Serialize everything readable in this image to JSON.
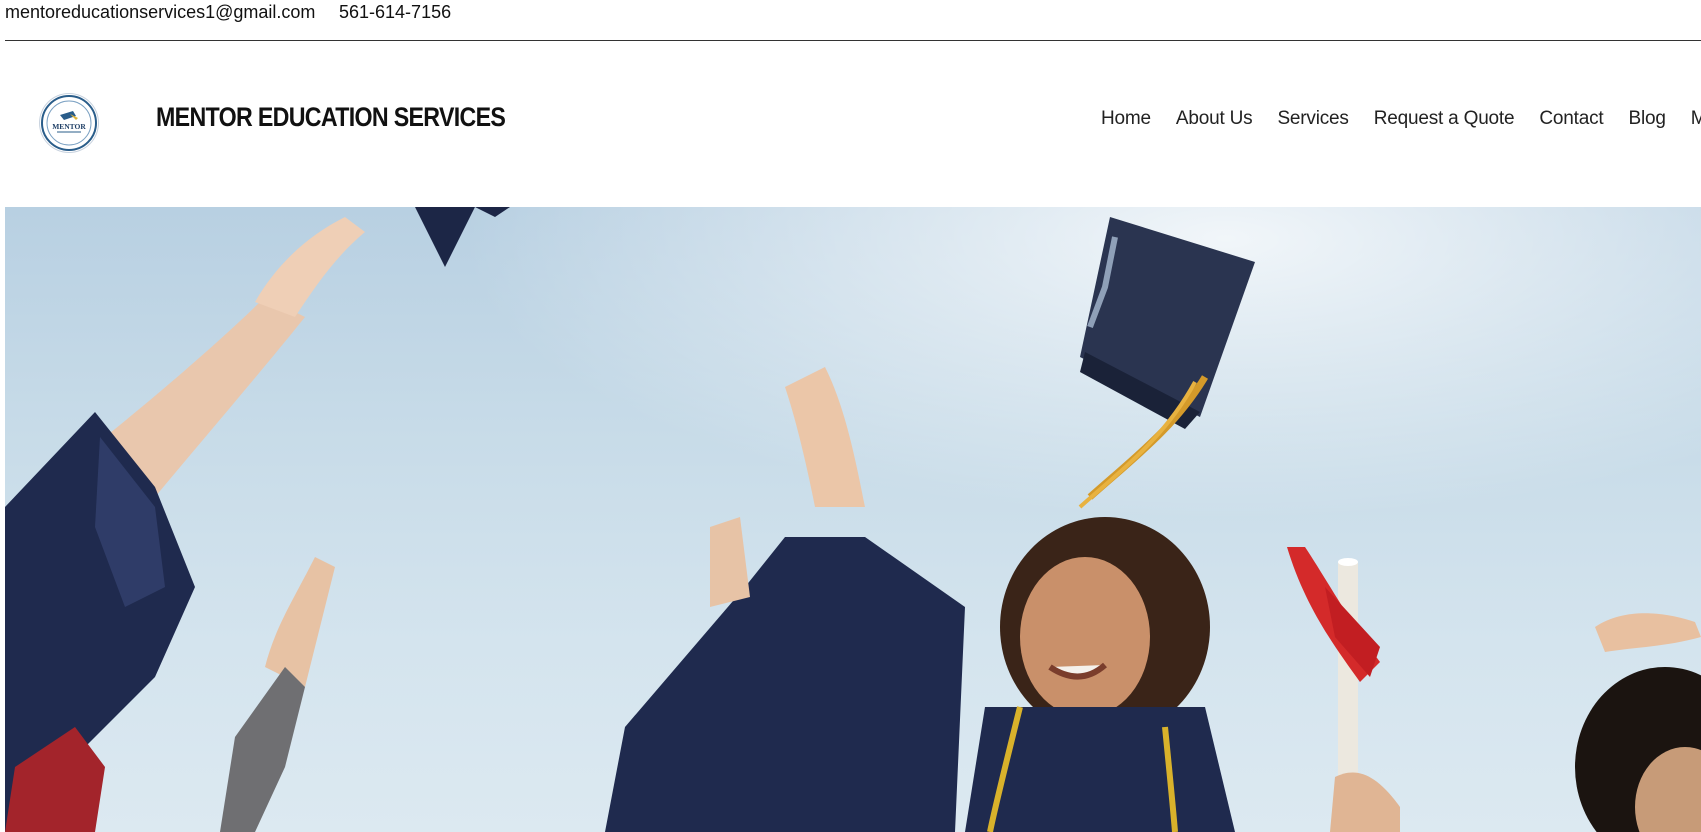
{
  "contact": {
    "email": "mentoreducationservices1@gmail.com",
    "phone": "561-614-7156"
  },
  "brand": {
    "logo_text": "MENTOR",
    "site_title": "MENTOR EDUCATION SERVICES"
  },
  "nav": {
    "items": [
      "Home",
      "About Us",
      "Services",
      "Request a Quote",
      "Contact",
      "Blog",
      "More"
    ]
  },
  "hero": {
    "image_icon": "graduation-cap-toss-photo"
  },
  "colors": {
    "sky": "#c7dbe8",
    "gown": "#1f2a4e",
    "cord": "#d9b22b",
    "ribbon": "#d42a2a",
    "logo_ring": "#2a5d8a"
  }
}
